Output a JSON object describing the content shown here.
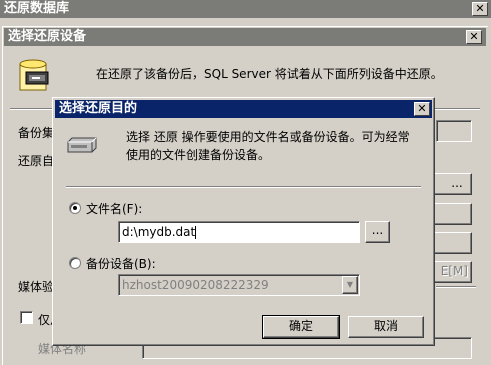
{
  "outer_window": {
    "title": "还原数据库",
    "close_icon": "✕"
  },
  "restore_dialog": {
    "title": "选择还原设备",
    "close_icon": "✕",
    "description": "在还原了该备份后，SQL Server 将试着从下面所列设备中还原。",
    "backup_set_label": "备份集",
    "restore_from_label": "还原自",
    "media_verify_label": "媒体验",
    "only_label": "仅从",
    "media_name_label": "媒体名称",
    "side_buttons": [
      "...",
      "",
      "",
      "E[M]"
    ]
  },
  "target_dialog": {
    "title": "选择还原目的",
    "close_icon": "✕",
    "description_line1": "选择 还原 操作要使用的文件名或备份设备。可为经常",
    "description_line2": "使用的文件创建备份设备。",
    "file_name_option": {
      "label": "文件名(F):",
      "checked": true
    },
    "file_name_value": "d:\\mydb.dat",
    "browse_label": "...",
    "backup_device_option": {
      "label": "备份设备(B):",
      "checked": false
    },
    "backup_device_value": "hzhost20090208222329",
    "dropdown_icon": "▼",
    "ok_label": "确定",
    "cancel_label": "取消"
  },
  "colors": {
    "active_title": "#0a246a",
    "inactive_title": "#7b7b78",
    "face": "#d4d0c8"
  }
}
